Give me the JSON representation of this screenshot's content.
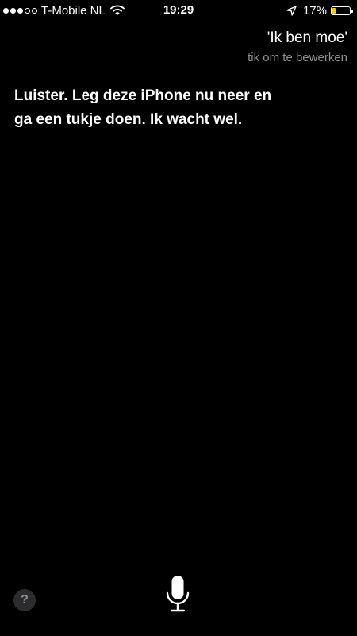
{
  "status_bar": {
    "carrier": "T-Mobile NL",
    "signal_bars_filled": 3,
    "signal_bars_total": 5,
    "time": "19:29",
    "battery_percent_label": "17%",
    "battery_level": 0.17,
    "battery_color": "#ffcc00",
    "icons": [
      "wifi-icon",
      "location-icon",
      "battery-icon"
    ]
  },
  "utterance": {
    "text": "'Ik ben moe'",
    "hint": "tik om te bewerken"
  },
  "response": {
    "line1": "Luister. Leg deze iPhone nu neer en",
    "line2": "ga een tukje doen. Ik wacht wel."
  },
  "controls": {
    "help_label": "?",
    "mic_icon": "microphone-icon"
  },
  "colors": {
    "background": "#000000",
    "text": "#ffffff",
    "secondary_text": "#8e8e93"
  }
}
